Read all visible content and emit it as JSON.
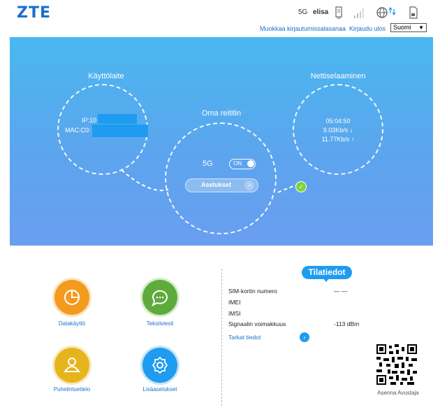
{
  "header": {
    "logo": "ZTE",
    "network_type": "5G",
    "operator": "elisa",
    "icons": [
      "sim-card-icon",
      "signal-bars-icon",
      "globe-transfer-icon",
      "sd-card-icon"
    ],
    "change_password_link": "Muokkaa kirjautumissalasanaa",
    "logout_link": "Kirjaudu ulos",
    "language": "Suomi"
  },
  "hero": {
    "device": {
      "title": "Käyttölaite",
      "ip_label": "IP:10",
      "mac_label": "MAC:C0:"
    },
    "router": {
      "title": "Oma reititin",
      "band": "5G",
      "toggle": "ON",
      "settings_button": "Asetukset"
    },
    "internet": {
      "title": "Nettiselaaminen",
      "uptime": "05:04:50",
      "download": "9.03Kb/s ↓",
      "upload": "11.77Kb/s ↑"
    }
  },
  "features": [
    {
      "label": "Datakäyttö",
      "color": "#f39b1e",
      "icon": "pie-chart-icon"
    },
    {
      "label": "Tekstiviesti",
      "color": "#5faa3c",
      "icon": "message-icon"
    },
    {
      "label": "Puhelinluettelo",
      "color": "#e6b41c",
      "icon": "contact-icon"
    },
    {
      "label": "Lisäasetukset",
      "color": "#1e9cf0",
      "icon": "gear-icon"
    }
  ],
  "status": {
    "title": "Tilatiedot",
    "rows": [
      {
        "label": "SIM-kortin numero",
        "value": "— —"
      },
      {
        "label": "IMEI",
        "value": ""
      },
      {
        "label": "IMSI",
        "value": ""
      },
      {
        "label": "Signaalin voimakkuus",
        "value": "-113 dBm"
      }
    ],
    "details_link": "Tarkat tiedot",
    "install_helper": "Asenna Avustaja"
  }
}
